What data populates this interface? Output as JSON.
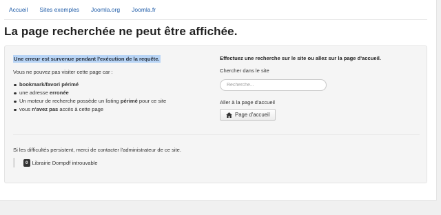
{
  "nav": {
    "items": [
      "Accueil",
      "Sites exemples",
      "Joomla.org",
      "Joomla.fr"
    ]
  },
  "page_title": "La page recherchée ne peut être affichée.",
  "error": {
    "title": "Une erreur est survenue pendant l'exécution de la requête.",
    "intro": "Vous ne pouvez pas visiter cette page car :",
    "reasons": [
      {
        "before": "",
        "bold": "bookmark/favori périmé",
        "after": ""
      },
      {
        "before": "une adresse ",
        "bold": "erronée",
        "after": ""
      },
      {
        "before": "Un moteur de recherche possède un listing ",
        "bold": "périmé",
        "after": " pour ce site"
      },
      {
        "before": "vous ",
        "bold": "n'avez pas",
        "after": " accès à cette page"
      }
    ]
  },
  "search": {
    "heading": "Effectuez une recherche sur le site ou allez sur la page d'accueil.",
    "label": "Chercher dans le site",
    "placeholder": "Recherche...",
    "value": ""
  },
  "home": {
    "label": "Aller à la page d'accueil",
    "button_label": "Page d'accueil",
    "button_icon": "home-icon"
  },
  "contact": "Si les difficultés persistent, merci de contacter l'administrateur de ce site.",
  "error_detail": {
    "code": "0",
    "message": "Librairie Dompdf introuvable"
  }
}
